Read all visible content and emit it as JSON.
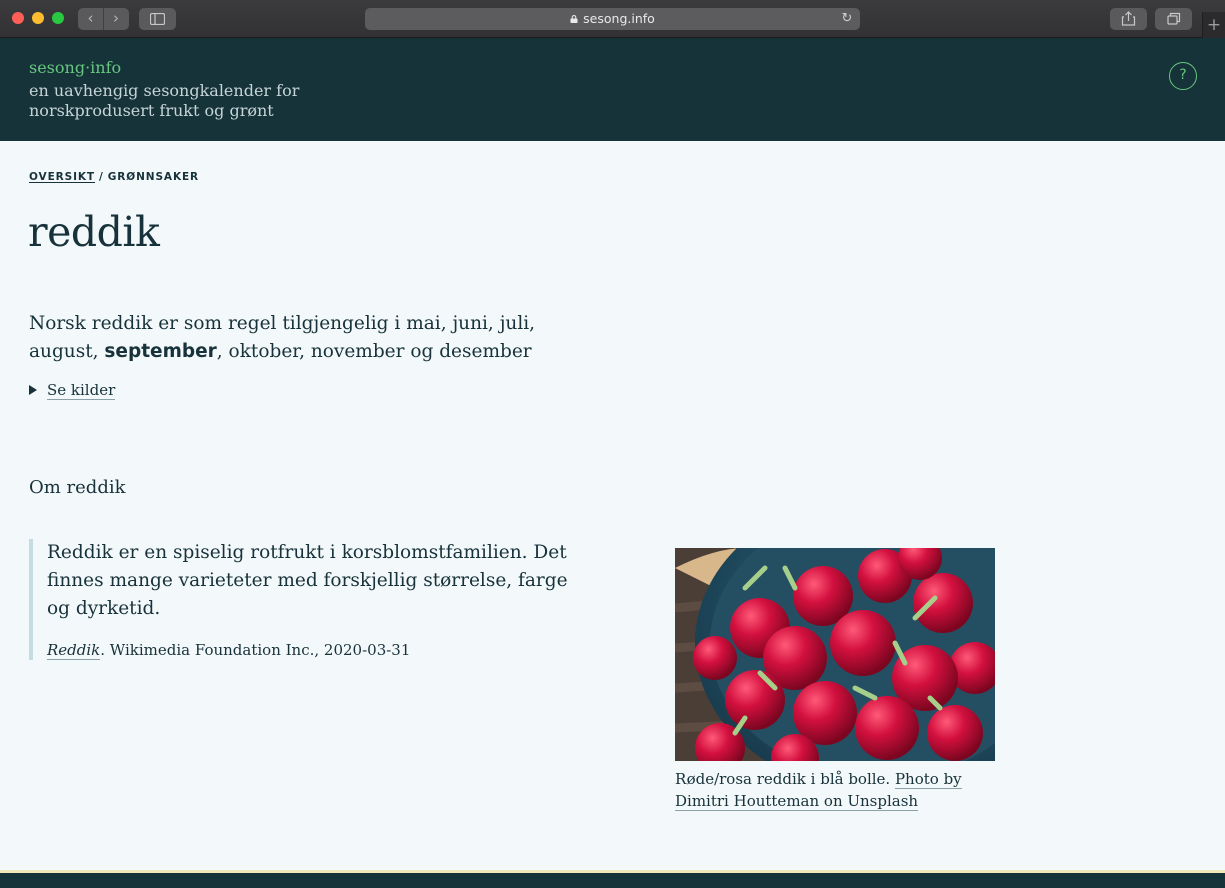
{
  "browser": {
    "url": "sesong.info",
    "back_label": "‹",
    "forward_label": "›",
    "reload_label": "↻",
    "newtab_label": "+"
  },
  "header": {
    "brand": "sesong·info",
    "tagline": "en uavhengig sesongkalender for norskprodusert frukt og grønt",
    "help_label": "?"
  },
  "breadcrumb": {
    "overview": "OVERSIKT",
    "separator": "/",
    "category": "GRØNNSAKER"
  },
  "page": {
    "title": "reddik",
    "season_intro": "Norsk reddik er som regel tilgjengelig i mai, juni, juli, august, ",
    "season_current": "september",
    "season_outro": ", oktober, november og desember",
    "sources_label": "Se kilder",
    "about_heading": "Om reddik"
  },
  "quote": {
    "text": "Reddik er en spiselig rotfrukt i korsblomstfamilien. Det finnes mange varieteter med forskjellig størrelse, farge og dyrketid.",
    "source_title": "Reddik",
    "source_rest": ". Wikimedia Foundation Inc., 2020-03-31"
  },
  "photo": {
    "caption": "Røde/rosa reddik i blå bolle. ",
    "credit": "Photo by Dimitri Houtteman on Unsplash"
  },
  "colors": {
    "header_bg": "#17333a",
    "accent_green": "#67c77f",
    "page_bg": "#f3f8fa",
    "quote_border": "#c6dbe2"
  }
}
